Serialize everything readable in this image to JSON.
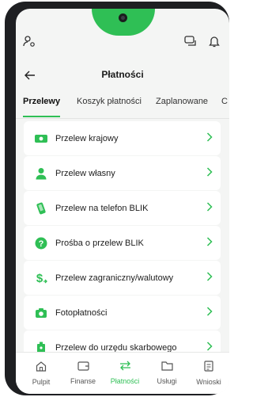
{
  "header": {
    "title": "Płatności"
  },
  "tabs": [
    {
      "label": "Przelewy",
      "active": true
    },
    {
      "label": "Koszyk płatności",
      "active": false
    },
    {
      "label": "Zaplanowane",
      "active": false
    },
    {
      "label": "C",
      "active": false
    }
  ],
  "items": [
    {
      "label": "Przelew krajowy",
      "icon": "cash-transfer-icon"
    },
    {
      "label": "Przelew własny",
      "icon": "person-icon"
    },
    {
      "label": "Przelew na telefon BLIK",
      "icon": "phone-blik-icon"
    },
    {
      "label": "Prośba o przelew BLIK",
      "icon": "question-circle-icon"
    },
    {
      "label": "Przelew zagraniczny/walutowy",
      "icon": "dollar-transfer-icon"
    },
    {
      "label": "Fotopłatności",
      "icon": "camera-icon"
    },
    {
      "label": "Przelew do urzędu skarbowego",
      "icon": "tax-office-icon"
    }
  ],
  "nav": [
    {
      "label": "Pulpit",
      "icon": "home-icon",
      "active": false
    },
    {
      "label": "Finanse",
      "icon": "wallet-icon",
      "active": false
    },
    {
      "label": "Płatności",
      "icon": "transfer-arrows-icon",
      "active": true
    },
    {
      "label": "Usługi",
      "icon": "folder-icon",
      "active": false
    },
    {
      "label": "Wnioski",
      "icon": "document-icon",
      "active": false
    }
  ],
  "colors": {
    "accent": "#2fbf55",
    "background": "#f4f5f4",
    "frame": "#1e1f22"
  }
}
